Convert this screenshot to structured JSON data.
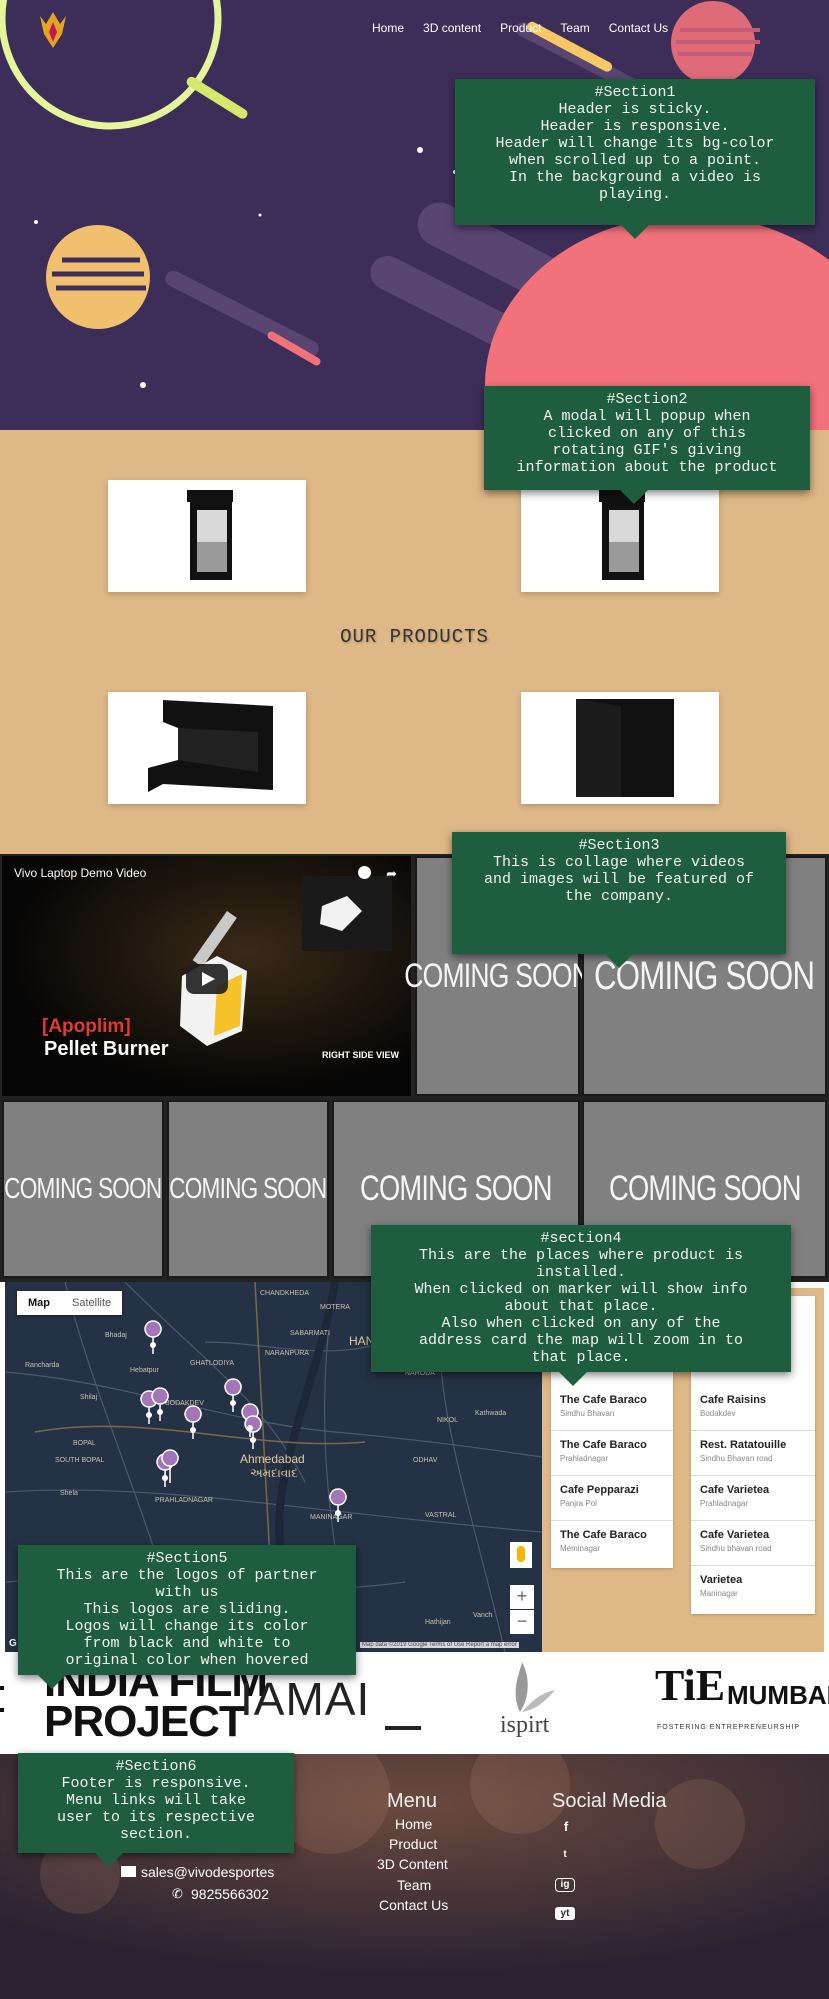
{
  "nav": {
    "items": [
      "Home",
      "3D content",
      "Product",
      "Team",
      "Contact Us"
    ]
  },
  "notes": {
    "section1": "#Section1\nHeader is sticky.\nHeader is responsive.\nHeader will change its bg-color\nwhen scrolled up to a point.\nIn the background a video is\nplaying.",
    "section2": "#Section2\nA modal will popup when\nclicked on any of this\nrotating GIF's giving\ninformation about the product",
    "section3": "#Section3\nThis is collage where videos\nand images will be featured of\nthe company.",
    "section4": "#section4\nThis are the places where product is\ninstalled.\nWhen clicked on marker will show info\nabout that place.\nAlso when clicked on any of the\naddress card the map will zoom in to\nthat place.",
    "section5": "#Section5\nThis are the logos of partner\nwith us\nThis logos are sliding.\nLogos will change its color\nfrom black and white to\noriginal color when hovered",
    "section6": "#Section6\nFooter is responsive.\nMenu links will take\nuser to its respective\nsection."
  },
  "products": {
    "title": "OUR PRODUCTS"
  },
  "collage": {
    "video_title": "Vivo Laptop Demo Video",
    "video_brand": "[Apoplim]",
    "video_brand2": "Pellet Burner",
    "video_caption": "RIGHT SIDE VIEW",
    "coming_soon": "COMING SOON"
  },
  "map": {
    "type_map": "Map",
    "type_satellite": "Satellite",
    "city": "Ahmedabad",
    "city_local": "અમદાવાદ",
    "labels": [
      "Rancharda",
      "Bhadaj",
      "Hebatpur",
      "Shilaj",
      "SOUTH BOPAL",
      "Shela",
      "BOPAL",
      "CHANDKHEDA",
      "MOTERA",
      "SABARMATI",
      "NARODA",
      "Kathwada",
      "ODHAV",
      "NIKOL",
      "VASTRAL",
      "MANINAGAR",
      "Hathijan",
      "Vanch",
      "GHATLODIYA",
      "NARANPURA",
      "PRAHLADNAGAR",
      "BODAKDEV",
      "HAN"
    ],
    "footer": "Map data ©2019 Google   Terms of Use   Report a map error",
    "google": "G",
    "zoom_in": "+",
    "zoom_out": "−"
  },
  "addresses": {
    "left": [
      {
        "name": "The Cafe Baraco",
        "area": "Sindhu Bhavan"
      },
      {
        "name": "The Cafe Baraco",
        "area": "Prahladnagar"
      },
      {
        "name": "Cafe Pepparazi",
        "area": "Panjra Pol"
      },
      {
        "name": "The Cafe Baraco",
        "area": "Meminagar"
      }
    ],
    "right": [
      {
        "name": "Cafe Raisins",
        "area": "Bodakdev"
      },
      {
        "name": "Rest. Ratatouille",
        "area": "Sindhu Bhavan road"
      },
      {
        "name": "Cafe Varietea",
        "area": "Prahladnagar"
      },
      {
        "name": "Cafe Varietea",
        "area": "Sindhu bhavan road"
      },
      {
        "name": "Varietea",
        "area": "Maninagar"
      }
    ]
  },
  "partners": {
    "india_film_line1": "INDIA FILM",
    "india_film_line2": "PROJECT",
    "iamai": "IAMAI",
    "ispirt": "ispirt",
    "tie": "TiE",
    "tie_city": "MUMBAI",
    "tie_tag": "FOSTERING ENTREPRENEURSHIP"
  },
  "footer": {
    "menu_heading": "Menu",
    "social_heading": "Social Media",
    "menu": [
      "Home",
      "Product",
      "3D Content",
      "Team",
      "Contact Us"
    ],
    "email": "sales@vivodesportes",
    "phone": "9825566302",
    "social": [
      "f",
      "t",
      "ig",
      "yt"
    ]
  },
  "colors": {
    "hero_bg": "#3d2d59",
    "products_bg": "#deb887",
    "note_bg": "#1e5e3e",
    "planet_pink": "#f2727b",
    "footer_bg": "#2d2638"
  }
}
